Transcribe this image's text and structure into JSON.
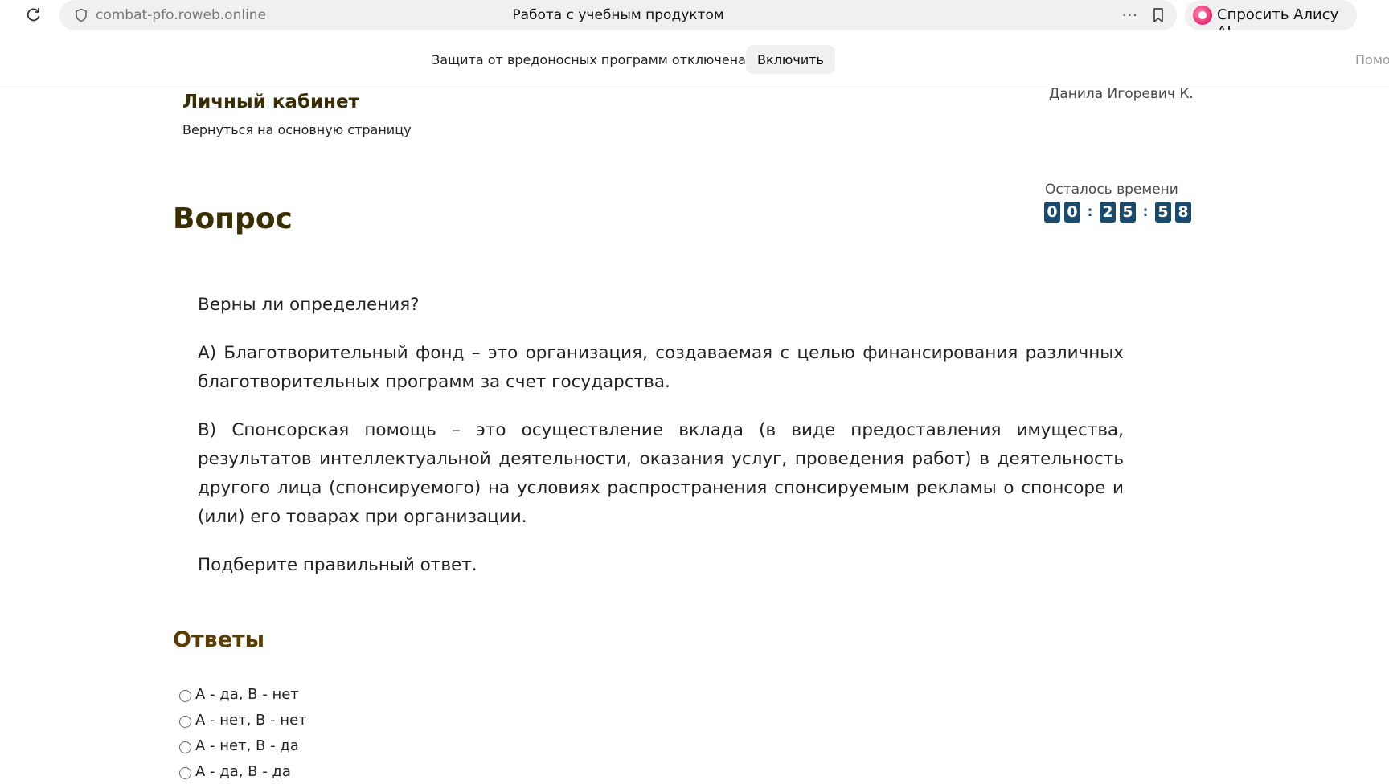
{
  "browser": {
    "url": "combat-pfo.roweb.online",
    "tab_title": "Работа с учебным продуктом",
    "menu_dots": "···",
    "alice_label": "Спросить Алису AI"
  },
  "notice": {
    "text": "Защита от вредоносных программ отключена",
    "enable_label": "Включить",
    "help_cut": "Помо"
  },
  "header": {
    "cabinet_title": "Личный кабинет",
    "back_link": "Вернуться на основную страницу",
    "user_name": "Данила Игоревич К."
  },
  "timer": {
    "label": "Осталось времени",
    "h1": "0",
    "h2": "0",
    "sep1": ":",
    "m1": "2",
    "m2": "5",
    "sep2": ":",
    "s1": "5",
    "s2": "8"
  },
  "question": {
    "heading": "Вопрос",
    "p1": "Верны ли определения?",
    "p2": "А) Благотворительный фонд – это организация, создаваемая с целью финансирования различных благотворительных программ за счет государства.",
    "p3": "В) Спонсорская помощь – это осуществление вклада (в виде предоставления имущества, результатов интеллектуальной деятельности, оказания услуг, проведения работ) в деятельность другого лица (спонсируемого) на условиях распространения спонсируемым рекламы о спонсоре и (или) его товарах при организации.",
    "p4": "Подберите правильный ответ."
  },
  "answers": {
    "heading": "Ответы",
    "options": [
      "А - да, В - нет",
      "А - нет, В - нет",
      "А - нет, В - да",
      "А - да, В - да"
    ]
  },
  "colors": {
    "heading_brown": "#3a2e05",
    "timer_blue": "#1a4a6e",
    "alice_pink": "#e8276e"
  }
}
